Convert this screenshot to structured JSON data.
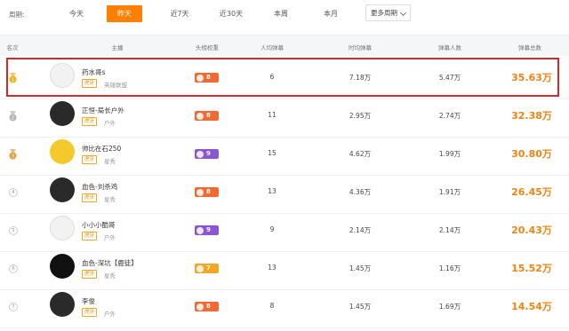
{
  "filter": {
    "label": "周期:",
    "tabs": [
      "今天",
      "昨天",
      "近7天",
      "近30天",
      "本周",
      "本月"
    ],
    "active_index": 1,
    "more_label": "更多周期"
  },
  "table": {
    "headers": {
      "rank": "名次",
      "anchor": "主播",
      "weight": "头榜权重",
      "avg": "人均弹幕",
      "peak": "时均弹幕",
      "users": "弹幕人数",
      "total": "弹幕总数"
    },
    "rows": [
      {
        "rank": "1",
        "medal": "gold",
        "name": "药水哥s",
        "tag": "虎牙",
        "category": "英雄联盟",
        "weight": "8",
        "weight_color": "orange",
        "avg": "6",
        "peak": "7.18万",
        "users": "5.47万",
        "total": "35.63万"
      },
      {
        "rank": "2",
        "medal": "silver",
        "name": "正恒-局长户外",
        "tag": "虎牙",
        "category": "户外",
        "weight": "8",
        "weight_color": "orange",
        "avg": "11",
        "peak": "2.95万",
        "users": "2.74万",
        "total": "32.38万"
      },
      {
        "rank": "3",
        "medal": "bronze",
        "name": "帅比在石250",
        "tag": "虎牙",
        "category": "星秀",
        "weight": "9",
        "weight_color": "purple",
        "avg": "15",
        "peak": "4.62万",
        "users": "1.99万",
        "total": "30.80万"
      },
      {
        "rank": "4",
        "medal": "",
        "name": "血色-刘杀鸡",
        "tag": "虎牙",
        "category": "星秀",
        "weight": "8",
        "weight_color": "orange",
        "avg": "13",
        "peak": "4.36万",
        "users": "1.91万",
        "total": "26.45万"
      },
      {
        "rank": "5",
        "medal": "",
        "name": "小小小酷哥",
        "tag": "虎牙",
        "category": "户外",
        "weight": "9",
        "weight_color": "purple",
        "avg": "9",
        "peak": "2.14万",
        "users": "2.14万",
        "total": "20.43万"
      },
      {
        "rank": "6",
        "medal": "",
        "name": "血色-深坑【鹿徒】",
        "tag": "虎牙",
        "category": "星秀",
        "weight": "7",
        "weight_color": "gold",
        "avg": "13",
        "peak": "1.45万",
        "users": "1.16万",
        "total": "15.52万"
      },
      {
        "rank": "7",
        "medal": "",
        "name": "李俊",
        "tag": "虎牙",
        "category": "户外",
        "weight": "8",
        "weight_color": "orange",
        "avg": "8",
        "peak": "1.45万",
        "users": "1.69万",
        "total": "14.54万"
      }
    ]
  },
  "colors": {
    "accent": "#ff7f00",
    "total_text": "#f5820f",
    "highlight_border": "#d42a2a",
    "medal_gold": "#f0b323",
    "medal_silver": "#b5b5b5",
    "medal_bronze": "#e0a040"
  },
  "icons": {
    "medal": "medal-icon",
    "weight": "weight-badge-icon",
    "dropdown": "chevron-down-icon"
  }
}
